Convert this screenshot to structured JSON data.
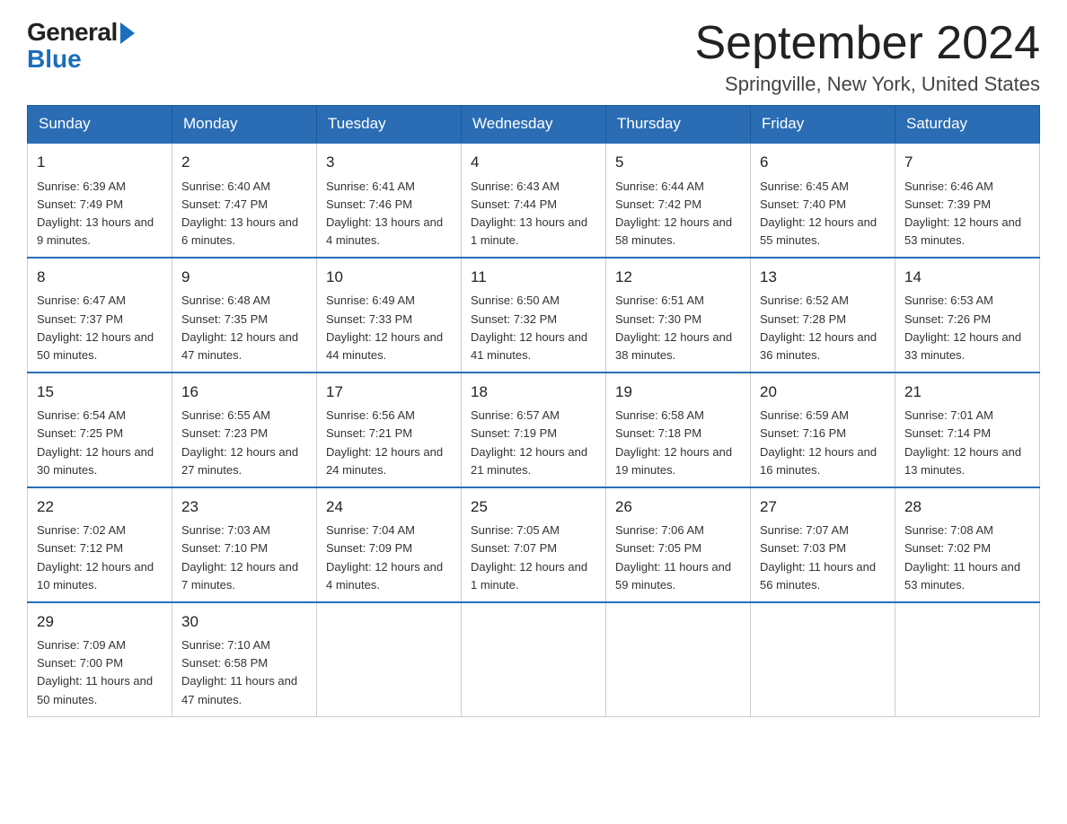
{
  "header": {
    "logo": {
      "general": "General",
      "blue": "Blue"
    },
    "title": "September 2024",
    "subtitle": "Springville, New York, United States"
  },
  "weekdays": [
    "Sunday",
    "Monday",
    "Tuesday",
    "Wednesday",
    "Thursday",
    "Friday",
    "Saturday"
  ],
  "weeks": [
    [
      {
        "day": "1",
        "sunrise": "6:39 AM",
        "sunset": "7:49 PM",
        "daylight": "13 hours and 9 minutes."
      },
      {
        "day": "2",
        "sunrise": "6:40 AM",
        "sunset": "7:47 PM",
        "daylight": "13 hours and 6 minutes."
      },
      {
        "day": "3",
        "sunrise": "6:41 AM",
        "sunset": "7:46 PM",
        "daylight": "13 hours and 4 minutes."
      },
      {
        "day": "4",
        "sunrise": "6:43 AM",
        "sunset": "7:44 PM",
        "daylight": "13 hours and 1 minute."
      },
      {
        "day": "5",
        "sunrise": "6:44 AM",
        "sunset": "7:42 PM",
        "daylight": "12 hours and 58 minutes."
      },
      {
        "day": "6",
        "sunrise": "6:45 AM",
        "sunset": "7:40 PM",
        "daylight": "12 hours and 55 minutes."
      },
      {
        "day": "7",
        "sunrise": "6:46 AM",
        "sunset": "7:39 PM",
        "daylight": "12 hours and 53 minutes."
      }
    ],
    [
      {
        "day": "8",
        "sunrise": "6:47 AM",
        "sunset": "7:37 PM",
        "daylight": "12 hours and 50 minutes."
      },
      {
        "day": "9",
        "sunrise": "6:48 AM",
        "sunset": "7:35 PM",
        "daylight": "12 hours and 47 minutes."
      },
      {
        "day": "10",
        "sunrise": "6:49 AM",
        "sunset": "7:33 PM",
        "daylight": "12 hours and 44 minutes."
      },
      {
        "day": "11",
        "sunrise": "6:50 AM",
        "sunset": "7:32 PM",
        "daylight": "12 hours and 41 minutes."
      },
      {
        "day": "12",
        "sunrise": "6:51 AM",
        "sunset": "7:30 PM",
        "daylight": "12 hours and 38 minutes."
      },
      {
        "day": "13",
        "sunrise": "6:52 AM",
        "sunset": "7:28 PM",
        "daylight": "12 hours and 36 minutes."
      },
      {
        "day": "14",
        "sunrise": "6:53 AM",
        "sunset": "7:26 PM",
        "daylight": "12 hours and 33 minutes."
      }
    ],
    [
      {
        "day": "15",
        "sunrise": "6:54 AM",
        "sunset": "7:25 PM",
        "daylight": "12 hours and 30 minutes."
      },
      {
        "day": "16",
        "sunrise": "6:55 AM",
        "sunset": "7:23 PM",
        "daylight": "12 hours and 27 minutes."
      },
      {
        "day": "17",
        "sunrise": "6:56 AM",
        "sunset": "7:21 PM",
        "daylight": "12 hours and 24 minutes."
      },
      {
        "day": "18",
        "sunrise": "6:57 AM",
        "sunset": "7:19 PM",
        "daylight": "12 hours and 21 minutes."
      },
      {
        "day": "19",
        "sunrise": "6:58 AM",
        "sunset": "7:18 PM",
        "daylight": "12 hours and 19 minutes."
      },
      {
        "day": "20",
        "sunrise": "6:59 AM",
        "sunset": "7:16 PM",
        "daylight": "12 hours and 16 minutes."
      },
      {
        "day": "21",
        "sunrise": "7:01 AM",
        "sunset": "7:14 PM",
        "daylight": "12 hours and 13 minutes."
      }
    ],
    [
      {
        "day": "22",
        "sunrise": "7:02 AM",
        "sunset": "7:12 PM",
        "daylight": "12 hours and 10 minutes."
      },
      {
        "day": "23",
        "sunrise": "7:03 AM",
        "sunset": "7:10 PM",
        "daylight": "12 hours and 7 minutes."
      },
      {
        "day": "24",
        "sunrise": "7:04 AM",
        "sunset": "7:09 PM",
        "daylight": "12 hours and 4 minutes."
      },
      {
        "day": "25",
        "sunrise": "7:05 AM",
        "sunset": "7:07 PM",
        "daylight": "12 hours and 1 minute."
      },
      {
        "day": "26",
        "sunrise": "7:06 AM",
        "sunset": "7:05 PM",
        "daylight": "11 hours and 59 minutes."
      },
      {
        "day": "27",
        "sunrise": "7:07 AM",
        "sunset": "7:03 PM",
        "daylight": "11 hours and 56 minutes."
      },
      {
        "day": "28",
        "sunrise": "7:08 AM",
        "sunset": "7:02 PM",
        "daylight": "11 hours and 53 minutes."
      }
    ],
    [
      {
        "day": "29",
        "sunrise": "7:09 AM",
        "sunset": "7:00 PM",
        "daylight": "11 hours and 50 minutes."
      },
      {
        "day": "30",
        "sunrise": "7:10 AM",
        "sunset": "6:58 PM",
        "daylight": "11 hours and 47 minutes."
      },
      null,
      null,
      null,
      null,
      null
    ]
  ]
}
